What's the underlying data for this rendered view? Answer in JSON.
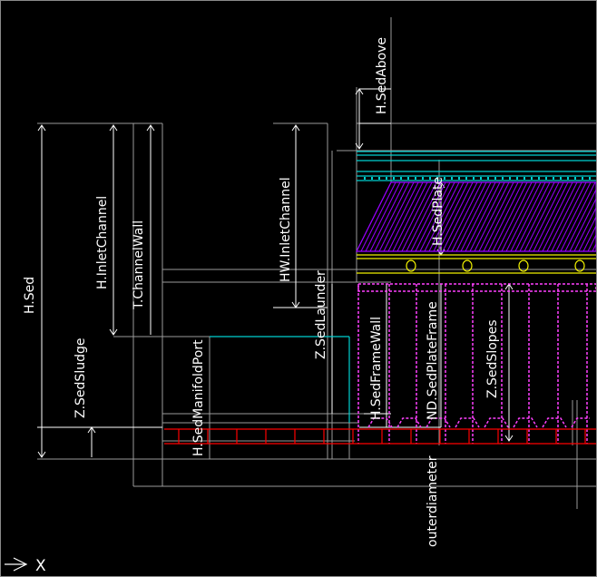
{
  "drawing": {
    "labels": {
      "h_sed": "H.Sed",
      "h_inlet_channel": "H.InletChannel",
      "t_channel_wall": "T.ChannelWall",
      "z_sed_sludge": "Z.SedSludge",
      "h_sed_manifold_port": "H.SedManifoldPort",
      "hw_inlet_channel": "HW.InletChannel",
      "z_sed_launder": "Z.SedLaunder",
      "h_sed_above": "H.SedAbove",
      "h_sed_plate": "H.SedPlate",
      "h_sed_frame_wall": "H.SedFrameWall",
      "nd_sed_plate_frame": "ND.SedPlateFrame",
      "z_sed_slopes": "Z.SedSlopes",
      "outer_diameter": "outerdiameter"
    },
    "ucs_axis_label": "X"
  },
  "colors": {
    "background": "#000000",
    "dimension_line": "#ffffff",
    "cyan": "#00d0d0",
    "purple": "#9a00ff",
    "magenta": "#ff40ff",
    "yellow": "#f0f000",
    "red": "#ff0000",
    "grey": "#9a9a9a"
  }
}
